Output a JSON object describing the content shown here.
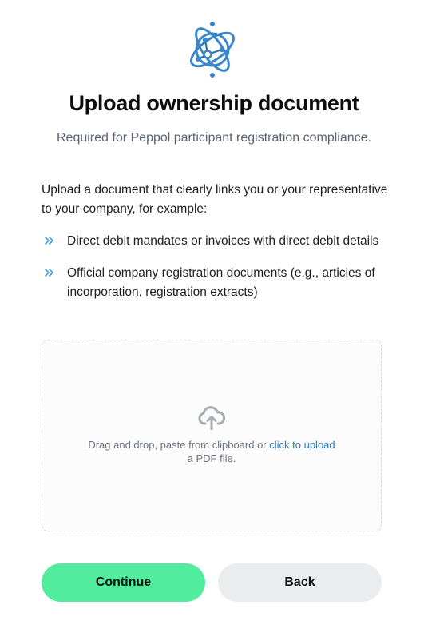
{
  "header": {
    "logo_icon": "network-globe-icon",
    "title": "Upload ownership document",
    "subtitle": "Required for Peppol participant registration compliance."
  },
  "content": {
    "intro": "Upload a document that clearly links you or your representative to your company, for example:",
    "examples": [
      {
        "icon": "double-chevron-right-icon",
        "text": "Direct debit mandates or invoices with direct debit details"
      },
      {
        "icon": "double-chevron-right-icon",
        "text": "Official company registration documents (e.g., articles of incorporation, registration extracts)"
      }
    ]
  },
  "dropzone": {
    "icon": "cloud-upload-icon",
    "text_before_link": "Drag and drop, paste from clipboard or ",
    "link_text": "click to upload",
    "text_after": "a PDF file."
  },
  "actions": {
    "continue_label": "Continue",
    "back_label": "Back"
  },
  "colors": {
    "accent_green": "#52ec9e",
    "link_blue": "#2a7bc4",
    "logo_blue": "#3a86c8",
    "secondary_button": "#ebecee"
  }
}
